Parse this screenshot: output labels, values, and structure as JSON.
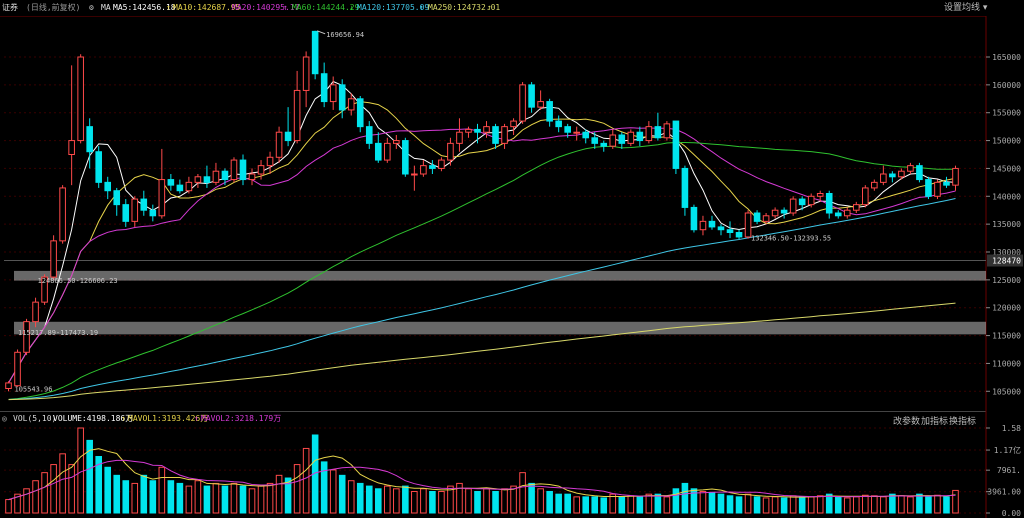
{
  "header": {
    "symbol": "证券",
    "period": "(日线,前复权)",
    "indicator_name": "MA",
    "ma5": "MA5:142456.18",
    "ma10": "MA10:142687.95",
    "ma20": "MA20:140295.17",
    "ma60": "MA60:144244.29",
    "ma120": "MA120:137705.09",
    "ma250": "MA250:124732.01",
    "settings_label": "设置均线"
  },
  "vol_header": {
    "name": "VOL(5,10)",
    "volume": "VOLUME:4198.186万",
    "mavol1": "MAVOL1:3193.426万",
    "mavol2": "MAVOL2:3218.179万",
    "btn_params": "改参数",
    "btn_add": "加指标",
    "btn_switch": "换指标"
  },
  "colors": {
    "up": "#ff4a4a",
    "down": "#00e5ee",
    "ma5": "#ffffff",
    "ma10": "#e6d34a",
    "ma20": "#d43ad4",
    "ma60": "#2fc22f",
    "ma120": "#3fc6e6",
    "ma250": "#d8d86a"
  },
  "chart_data": [
    {
      "type": "candlestick",
      "ylim": [
        102000,
        172000
      ],
      "y_ticks": [
        "165000",
        "160000",
        "155000",
        "150000",
        "145000",
        "140000",
        "135000",
        "130000",
        "125000",
        "120000",
        "115000",
        "110000",
        "105000"
      ],
      "current_price_label": "128470",
      "annotations": {
        "high": "169656.94",
        "low_recent": "132346.50-132393.55",
        "low_start": "105543.96",
        "zone_upper": "124866.50-126606.23",
        "zone_lower": "115217.89-117473.19"
      },
      "zones": [
        [
          124866.5,
          126606.23
        ],
        [
          115217.89,
          117473.19
        ]
      ],
      "candles": [
        [
          105500,
          106500,
          105000,
          106800
        ],
        [
          106000,
          112000,
          105800,
          112500
        ],
        [
          112000,
          117500,
          111500,
          118000
        ],
        [
          117500,
          121000,
          116500,
          121800
        ],
        [
          121000,
          125500,
          120500,
          126000
        ],
        [
          125500,
          132000,
          125000,
          133000
        ],
        [
          132000,
          141500,
          131500,
          142000
        ],
        [
          147500,
          150000,
          142000,
          163500
        ],
        [
          150000,
          165000,
          149500,
          165500
        ],
        [
          152500,
          148000,
          145000,
          154000
        ],
        [
          148000,
          142500,
          141500,
          149000
        ],
        [
          142500,
          141000,
          139500,
          143500
        ],
        [
          141000,
          138500,
          136500,
          141500
        ],
        [
          138500,
          135500,
          134500,
          139500
        ],
        [
          135500,
          139500,
          134500,
          140000
        ],
        [
          139500,
          137500,
          136500,
          141000
        ],
        [
          137500,
          136500,
          135500,
          138500
        ],
        [
          136500,
          143000,
          136000,
          148500
        ],
        [
          143000,
          142000,
          141000,
          144000
        ],
        [
          142000,
          141000,
          140500,
          143000
        ],
        [
          141000,
          142500,
          140500,
          143500
        ],
        [
          142500,
          143500,
          141500,
          144000
        ],
        [
          143500,
          142500,
          141500,
          145500
        ],
        [
          142500,
          144500,
          142000,
          146000
        ],
        [
          144500,
          143000,
          142000,
          145000
        ],
        [
          143000,
          146500,
          142500,
          147000
        ],
        [
          146500,
          143000,
          142000,
          147500
        ],
        [
          143000,
          144000,
          142000,
          145000
        ],
        [
          144000,
          145500,
          143000,
          146500
        ],
        [
          145500,
          147000,
          144000,
          148000
        ],
        [
          147000,
          151500,
          146000,
          152500
        ],
        [
          151500,
          150000,
          149000,
          156000
        ],
        [
          150000,
          159000,
          149500,
          162500
        ],
        [
          159000,
          165000,
          156000,
          166000
        ],
        [
          169600,
          162000,
          161000,
          169700
        ],
        [
          162000,
          157000,
          156000,
          164000
        ],
        [
          157000,
          160000,
          155500,
          161500
        ],
        [
          160000,
          155500,
          154000,
          161000
        ],
        [
          155500,
          157500,
          154500,
          158500
        ],
        [
          157500,
          152500,
          151500,
          158000
        ],
        [
          152500,
          149500,
          148500,
          153500
        ],
        [
          149500,
          146500,
          146000,
          151500
        ],
        [
          146500,
          149500,
          146000,
          150500
        ],
        [
          149500,
          150000,
          148500,
          151000
        ],
        [
          150000,
          144000,
          143500,
          150500
        ],
        [
          144000,
          144000,
          141000,
          145500
        ],
        [
          144000,
          145500,
          143500,
          146500
        ],
        [
          145500,
          145000,
          144000,
          146500
        ],
        [
          145000,
          146500,
          144500,
          147000
        ],
        [
          146500,
          149500,
          145500,
          150500
        ],
        [
          149500,
          151500,
          148000,
          154000
        ],
        [
          151500,
          152000,
          150500,
          152500
        ],
        [
          152000,
          151500,
          149500,
          153000
        ],
        [
          151500,
          152500,
          150500,
          153500
        ],
        [
          152500,
          149500,
          148500,
          153000
        ],
        [
          149500,
          152500,
          148500,
          153000
        ],
        [
          152500,
          153500,
          151000,
          154000
        ],
        [
          153500,
          160000,
          153000,
          160500
        ],
        [
          160000,
          156000,
          155000,
          160500
        ],
        [
          156000,
          157000,
          155500,
          159000
        ],
        [
          157000,
          153500,
          152500,
          157500
        ],
        [
          153500,
          152500,
          151500,
          154500
        ],
        [
          152500,
          151500,
          150500,
          153000
        ],
        [
          151500,
          151500,
          150000,
          152500
        ],
        [
          151500,
          150500,
          149500,
          152000
        ],
        [
          150500,
          149500,
          148500,
          151500
        ],
        [
          149500,
          149000,
          148000,
          150000
        ],
        [
          149000,
          151000,
          148500,
          152000
        ],
        [
          151000,
          149500,
          148500,
          151500
        ],
        [
          149500,
          151500,
          149000,
          152000
        ],
        [
          151500,
          150000,
          149000,
          152500
        ],
        [
          150000,
          152500,
          149500,
          153500
        ],
        [
          152500,
          150500,
          150000,
          155000
        ],
        [
          150500,
          153000,
          150000,
          153500
        ],
        [
          153500,
          145000,
          144000,
          153500
        ],
        [
          145000,
          138000,
          136500,
          145500
        ],
        [
          138000,
          134000,
          133500,
          138500
        ],
        [
          134000,
          135500,
          133000,
          136500
        ],
        [
          135500,
          134500,
          134000,
          136500
        ],
        [
          134500,
          134000,
          133000,
          135000
        ],
        [
          134000,
          133500,
          132500,
          135500
        ],
        [
          133500,
          132700,
          132300,
          134000
        ],
        [
          132700,
          137000,
          132400,
          137500
        ],
        [
          137000,
          135500,
          135000,
          137500
        ],
        [
          135500,
          136500,
          135000,
          137000
        ],
        [
          136500,
          137500,
          136000,
          138000
        ],
        [
          137500,
          137000,
          136000,
          138000
        ],
        [
          137000,
          139500,
          136500,
          140000
        ],
        [
          139500,
          138500,
          137500,
          140000
        ],
        [
          138500,
          140000,
          138000,
          140500
        ],
        [
          140000,
          140500,
          139000,
          141000
        ],
        [
          140500,
          137000,
          136000,
          141000
        ],
        [
          137000,
          136500,
          136000,
          137500
        ],
        [
          136500,
          137500,
          136000,
          138000
        ],
        [
          137500,
          138500,
          137000,
          139000
        ],
        [
          138500,
          141500,
          138000,
          142000
        ],
        [
          141500,
          142500,
          141000,
          143000
        ],
        [
          142500,
          144000,
          142000,
          145500
        ],
        [
          144000,
          143500,
          142500,
          144500
        ],
        [
          143500,
          144500,
          143000,
          145000
        ],
        [
          144500,
          145500,
          144000,
          146000
        ],
        [
          145500,
          143000,
          142500,
          146000
        ],
        [
          143000,
          140000,
          139500,
          143500
        ],
        [
          140000,
          142500,
          139500,
          143000
        ],
        [
          142500,
          142000,
          141500,
          143500
        ],
        [
          142000,
          145000,
          141000,
          145500
        ]
      ],
      "volume": {
        "ylim": [
          0,
          1.58
        ],
        "y_ticks": [
          "1.58",
          "1.17亿",
          "7961.",
          "3961.00",
          "0.00"
        ],
        "y_tick_values": [
          1.58,
          1.17,
          0.7961,
          0.3961,
          0.0
        ],
        "values": [
          0.25,
          0.35,
          0.45,
          0.6,
          0.75,
          0.9,
          1.1,
          0.9,
          1.58,
          1.35,
          1.05,
          0.85,
          0.7,
          0.6,
          0.55,
          0.7,
          0.6,
          0.85,
          0.6,
          0.55,
          0.5,
          0.6,
          0.5,
          0.55,
          0.5,
          0.55,
          0.5,
          0.45,
          0.5,
          0.55,
          0.7,
          0.65,
          0.9,
          1.2,
          1.45,
          0.95,
          0.8,
          0.7,
          0.6,
          0.55,
          0.5,
          0.45,
          0.5,
          0.45,
          0.5,
          0.4,
          0.45,
          0.4,
          0.4,
          0.5,
          0.55,
          0.45,
          0.4,
          0.45,
          0.4,
          0.45,
          0.5,
          0.75,
          0.55,
          0.45,
          0.4,
          0.35,
          0.35,
          0.3,
          0.3,
          0.3,
          0.28,
          0.35,
          0.3,
          0.32,
          0.3,
          0.35,
          0.35,
          0.3,
          0.45,
          0.55,
          0.45,
          0.4,
          0.38,
          0.35,
          0.32,
          0.3,
          0.35,
          0.3,
          0.28,
          0.3,
          0.28,
          0.32,
          0.3,
          0.3,
          0.32,
          0.35,
          0.3,
          0.28,
          0.3,
          0.33,
          0.32,
          0.3,
          0.35,
          0.32,
          0.3,
          0.35,
          0.3,
          0.33,
          0.3,
          0.42
        ]
      }
    }
  ]
}
